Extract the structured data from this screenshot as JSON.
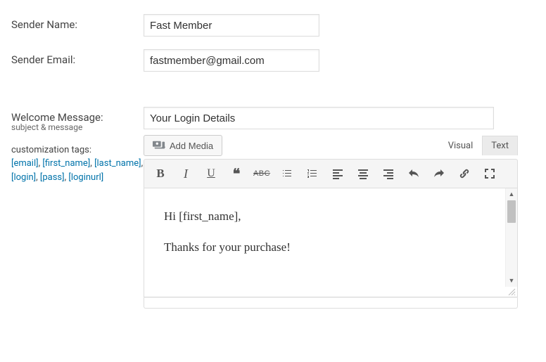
{
  "fields": {
    "sender_name": {
      "label": "Sender Name:",
      "value": "Fast Member"
    },
    "sender_email": {
      "label": "Sender Email:",
      "value": "fastmember@gmail.com"
    },
    "welcome": {
      "label": "Welcome Message:",
      "subtitle": "subject & message",
      "subject_value": "Your Login Details"
    }
  },
  "customization": {
    "label": "customization tags:",
    "tags": [
      "[email]",
      "[first_name]",
      "[last_name]",
      "[login]",
      "[pass]",
      "[loginurl]"
    ]
  },
  "editor": {
    "add_media_label": "Add Media",
    "tabs": {
      "visual": "Visual",
      "text": "Text"
    },
    "content": {
      "line1": "Hi [first_name],",
      "line2": "Thanks for your purchase!"
    }
  }
}
